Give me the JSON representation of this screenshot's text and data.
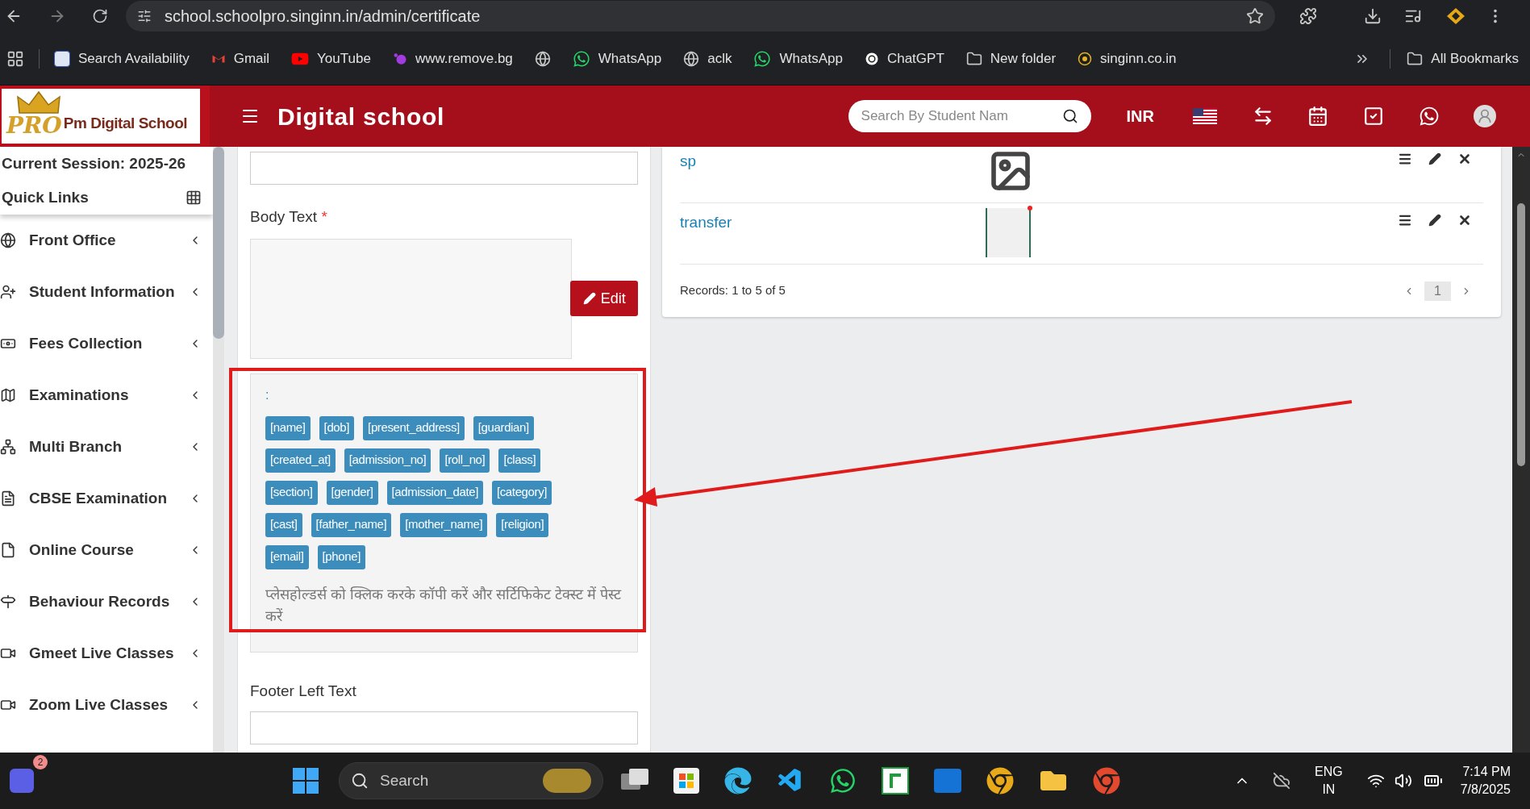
{
  "browser": {
    "url": "school.schoolpro.singinn.in/admin/certificate",
    "bookmarks": [
      {
        "kind": "link",
        "label": "Search Availability"
      },
      {
        "kind": "link",
        "label": "Gmail"
      },
      {
        "kind": "link",
        "label": "YouTube"
      },
      {
        "kind": "link",
        "label": "www.remove.bg"
      },
      {
        "kind": "icon"
      },
      {
        "kind": "link",
        "label": "WhatsApp"
      },
      {
        "kind": "link",
        "label": "aclk"
      },
      {
        "kind": "link",
        "label": "WhatsApp"
      },
      {
        "kind": "link",
        "label": "ChatGPT"
      },
      {
        "kind": "link",
        "label": "New folder"
      },
      {
        "kind": "link",
        "label": "singinn.co.in"
      }
    ],
    "all_bookmarks": "All Bookmarks"
  },
  "header": {
    "logo_badge": "PRO",
    "logo_text": "Pm Digital School",
    "title": "Digital school",
    "search_placeholder": "Search By Student Nam",
    "currency": "INR"
  },
  "sidebar": {
    "session": "Current Session: 2025-26",
    "quick_links": "Quick Links",
    "items": [
      {
        "label": "Front Office"
      },
      {
        "label": "Student Information"
      },
      {
        "label": "Fees Collection"
      },
      {
        "label": "Examinations"
      },
      {
        "label": "Multi Branch"
      },
      {
        "label": "CBSE Examination"
      },
      {
        "label": "Online Course"
      },
      {
        "label": "Behaviour Records"
      },
      {
        "label": "Gmeet Live Classes"
      },
      {
        "label": "Zoom Live Classes"
      }
    ]
  },
  "form": {
    "body_label": "Body Text",
    "required_mark": "*",
    "edit_button": "Edit",
    "placeholders": {
      "prefix": ":",
      "tags": [
        "[name]",
        "[dob]",
        "[present_address]",
        "[guardian]",
        "[created_at]",
        "[admission_no]",
        "[roll_no]",
        "[class]",
        "[section]",
        "[gender]",
        "[admission_date]",
        "[category]",
        "[cast]",
        "[father_name]",
        "[mother_name]",
        "[religion]",
        "[email]",
        "[phone]"
      ],
      "hint": "प्लेसहोल्डर्स को क्लिक करके कॉपी करें और सर्टिफिकेट टेक्स्ट में पेस्ट करें"
    },
    "footer_label": "Footer Left Text"
  },
  "table": {
    "rows": [
      {
        "name": "sp",
        "kind": "icon"
      },
      {
        "name": "transfer",
        "kind": "thumbnail"
      }
    ],
    "records": "Records: 1 to 5 of 5",
    "pages": [
      {
        "label": "1",
        "selected": true
      }
    ]
  },
  "taskbar": {
    "badge": "2",
    "search": "Search",
    "language": "ENG",
    "region": "IN",
    "time": "7:14 PM",
    "date": "7/8/2025"
  }
}
